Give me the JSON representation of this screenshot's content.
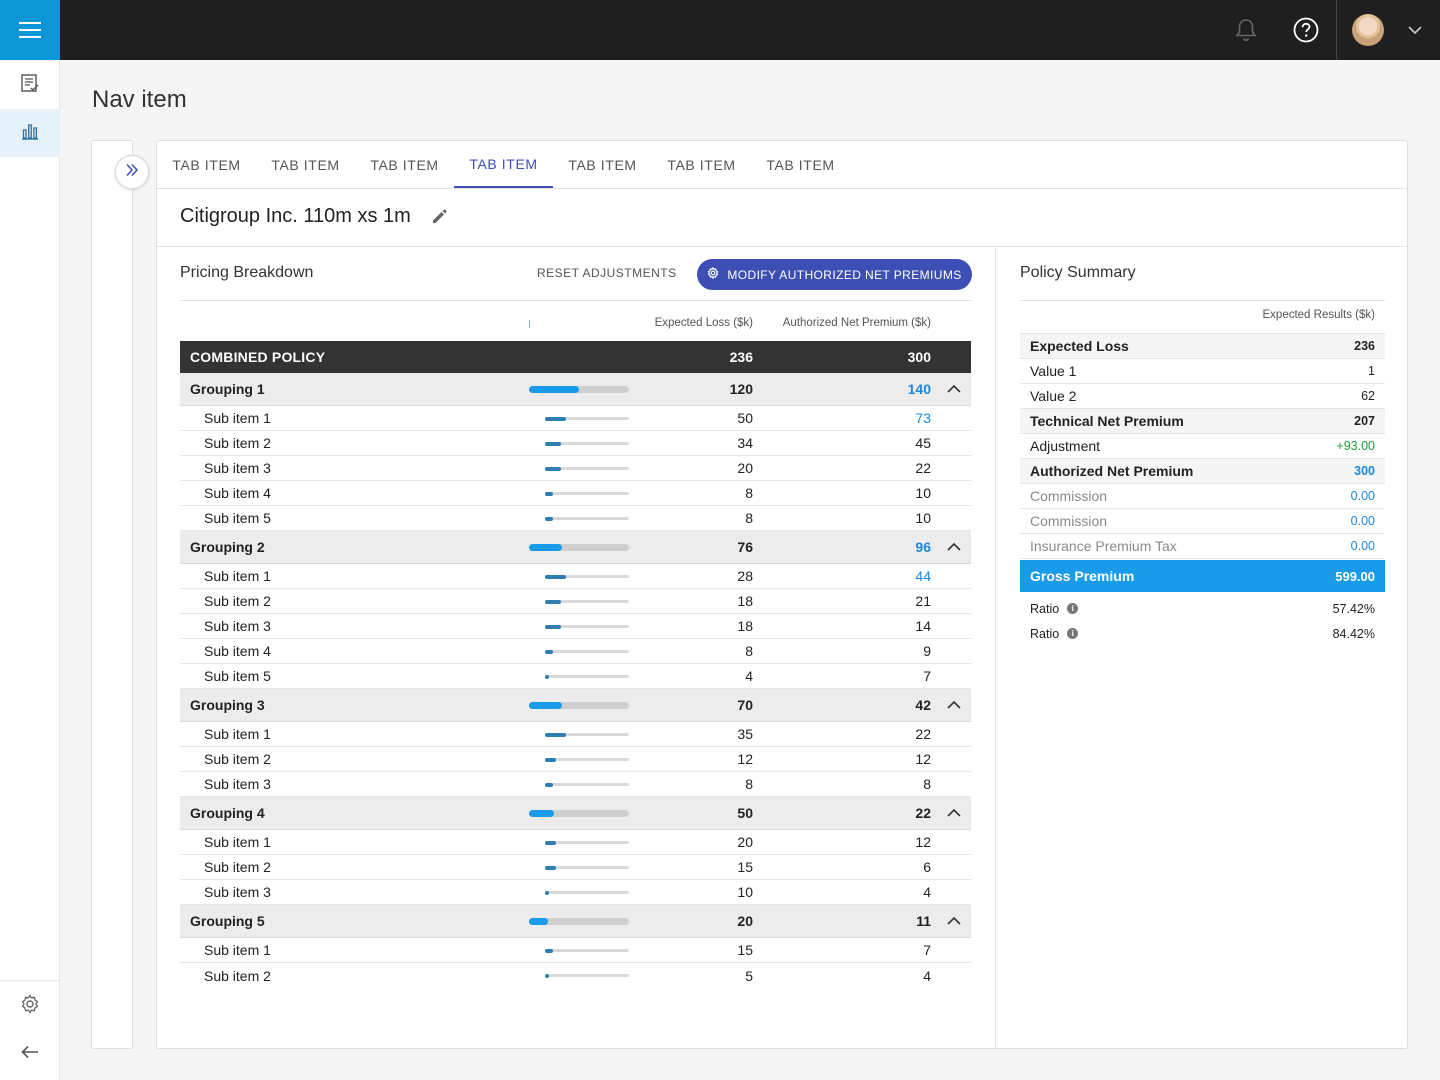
{
  "icons": {
    "menu": "hamburger-menu-icon",
    "bell": "bell-icon",
    "help": "question-circle-icon",
    "caret": "chevron-down-icon",
    "nav_doc": "document-check-icon",
    "nav_chart": "bar-chart-icon",
    "settings": "gear-icon",
    "back": "arrow-left-icon",
    "expand": "double-chevron-right-icon",
    "edit": "pencil-icon",
    "modify": "gear-icon",
    "collapse": "chevron-up-icon",
    "info": "info-icon"
  },
  "colors": {
    "brand": "#0d96d6",
    "primary_button": "#3d4fb5",
    "highlight_blue": "#1a88e0",
    "positive_green": "#1b9e3e",
    "gross_bar": "#1a9be9"
  },
  "page": {
    "title": "Nav item"
  },
  "tabs": [
    {
      "label": "TAB ITEM",
      "active": false
    },
    {
      "label": "TAB ITEM",
      "active": false
    },
    {
      "label": "TAB ITEM",
      "active": false
    },
    {
      "label": "TAB ITEM",
      "active": true
    },
    {
      "label": "TAB ITEM",
      "active": false
    },
    {
      "label": "TAB ITEM",
      "active": false
    },
    {
      "label": "TAB ITEM",
      "active": false
    }
  ],
  "document": {
    "title": "Citigroup Inc. 110m xs 1m"
  },
  "pricing": {
    "title": "Pricing Breakdown",
    "reset_label": "RESET ADJUSTMENTS",
    "modify_label": "MODIFY AUTHORIZED NET PREMIUMS",
    "col_expected_loss": "Expected Loss ($k)",
    "col_authorized": "Authorized Net Premium ($k)",
    "combined": {
      "label": "COMBINED POLICY",
      "expected_loss": "236",
      "authorized": "300"
    },
    "groups": [
      {
        "label": "Grouping 1",
        "expected_loss": "120",
        "authorized": "140",
        "authorized_highlight": true,
        "bar_share": 0.5,
        "items": [
          {
            "label": "Sub item 1",
            "expected_loss": "50",
            "authorized": "73",
            "authorized_highlight": true,
            "bar_share": 0.25
          },
          {
            "label": "Sub item 2",
            "expected_loss": "34",
            "authorized": "45",
            "authorized_highlight": false,
            "bar_share": 0.19
          },
          {
            "label": "Sub item 3",
            "expected_loss": "20",
            "authorized": "22",
            "authorized_highlight": false,
            "bar_share": 0.19
          },
          {
            "label": "Sub item 4",
            "expected_loss": "8",
            "authorized": "10",
            "authorized_highlight": false,
            "bar_share": 0.1
          },
          {
            "label": "Sub item 5",
            "expected_loss": "8",
            "authorized": "10",
            "authorized_highlight": false,
            "bar_share": 0.1
          }
        ]
      },
      {
        "label": "Grouping 2",
        "expected_loss": "76",
        "authorized": "96",
        "authorized_highlight": true,
        "bar_share": 0.33,
        "items": [
          {
            "label": "Sub item 1",
            "expected_loss": "28",
            "authorized": "44",
            "authorized_highlight": true,
            "bar_share": 0.25
          },
          {
            "label": "Sub item 2",
            "expected_loss": "18",
            "authorized": "21",
            "authorized_highlight": false,
            "bar_share": 0.19
          },
          {
            "label": "Sub item 3",
            "expected_loss": "18",
            "authorized": "14",
            "authorized_highlight": false,
            "bar_share": 0.19
          },
          {
            "label": "Sub item 4",
            "expected_loss": "8",
            "authorized": "9",
            "authorized_highlight": false,
            "bar_share": 0.1
          },
          {
            "label": "Sub item 5",
            "expected_loss": "4",
            "authorized": "7",
            "authorized_highlight": false,
            "bar_share": 0.05
          }
        ]
      },
      {
        "label": "Grouping 3",
        "expected_loss": "70",
        "authorized": "42",
        "authorized_highlight": false,
        "bar_share": 0.33,
        "items": [
          {
            "label": "Sub item 1",
            "expected_loss": "35",
            "authorized": "22",
            "authorized_highlight": false,
            "bar_share": 0.25
          },
          {
            "label": "Sub item 2",
            "expected_loss": "12",
            "authorized": "12",
            "authorized_highlight": false,
            "bar_share": 0.13
          },
          {
            "label": "Sub item 3",
            "expected_loss": "8",
            "authorized": "8",
            "authorized_highlight": false,
            "bar_share": 0.1
          }
        ]
      },
      {
        "label": "Grouping 4",
        "expected_loss": "50",
        "authorized": "22",
        "authorized_highlight": false,
        "bar_share": 0.25,
        "items": [
          {
            "label": "Sub item 1",
            "expected_loss": "20",
            "authorized": "12",
            "authorized_highlight": false,
            "bar_share": 0.13
          },
          {
            "label": "Sub item 2",
            "expected_loss": "15",
            "authorized": "6",
            "authorized_highlight": false,
            "bar_share": 0.13
          },
          {
            "label": "Sub item 3",
            "expected_loss": "10",
            "authorized": "4",
            "authorized_highlight": false,
            "bar_share": 0.05
          }
        ]
      },
      {
        "label": "Grouping 5",
        "expected_loss": "20",
        "authorized": "11",
        "authorized_highlight": false,
        "bar_share": 0.19,
        "items": [
          {
            "label": "Sub item 1",
            "expected_loss": "15",
            "authorized": "7",
            "authorized_highlight": false,
            "bar_share": 0.1
          },
          {
            "label": "Sub item 2",
            "expected_loss": "5",
            "authorized": "4",
            "authorized_highlight": false,
            "bar_share": 0.05
          }
        ]
      }
    ]
  },
  "summary": {
    "title": "Policy Summary",
    "col_header": "Expected Results ($k)",
    "rows": [
      {
        "label": "Expected Loss",
        "value": "236",
        "style": "bold",
        "value_color": ""
      },
      {
        "label": "Value 1",
        "value": "1",
        "style": "",
        "value_color": ""
      },
      {
        "label": "Value 2",
        "value": "62",
        "style": "",
        "value_color": ""
      },
      {
        "label": "Technical Net Premium",
        "value": "207",
        "style": "bold",
        "value_color": ""
      },
      {
        "label": "Adjustment",
        "value": "+93.00",
        "style": "",
        "value_color": "green"
      },
      {
        "label": "Authorized Net Premium",
        "value": "300",
        "style": "bold",
        "value_color": "blue"
      },
      {
        "label": "Commission",
        "value": "0.00",
        "style": "muted",
        "value_color": "blue"
      },
      {
        "label": "Commission",
        "value": "0.00",
        "style": "muted",
        "value_color": "blue"
      },
      {
        "label": "Insurance Premium Tax",
        "value": "0.00",
        "style": "muted",
        "value_color": "blue"
      }
    ],
    "total": {
      "label": "Gross Premium",
      "value": "599.00"
    },
    "ratios": [
      {
        "label": "Ratio",
        "value": "57.42%"
      },
      {
        "label": "Ratio",
        "value": "84.42%"
      }
    ]
  }
}
